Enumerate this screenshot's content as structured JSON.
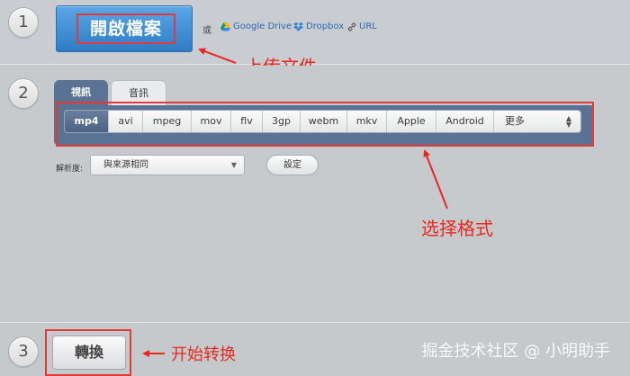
{
  "steps": [
    "1",
    "2",
    "3"
  ],
  "upload": {
    "open_file_label": "開啟檔案",
    "or_label": "或",
    "sources": [
      "Google Drive",
      "Dropbox",
      "URL"
    ]
  },
  "tabs": [
    {
      "label": "視訊",
      "active": true
    },
    {
      "label": "音訊",
      "active": false
    }
  ],
  "formats": {
    "items": [
      "mp4",
      "avi",
      "mpeg",
      "mov",
      "flv",
      "3gp",
      "webm",
      "mkv",
      "Apple",
      "Android"
    ],
    "selected": "mp4",
    "more_label": "更多"
  },
  "resolution": {
    "label": "解析度:",
    "value": "與來源相同",
    "settings_label": "設定"
  },
  "convert": {
    "label": "轉換"
  },
  "annotations": {
    "upload": "上传文件",
    "format": "选择格式",
    "convert": "开始转换"
  },
  "watermark": "掘金技术社区 @ 小明助手",
  "colors": {
    "primary_button": "#2f7cc6",
    "panel": "#5a7394",
    "annotation": "#e53935"
  }
}
